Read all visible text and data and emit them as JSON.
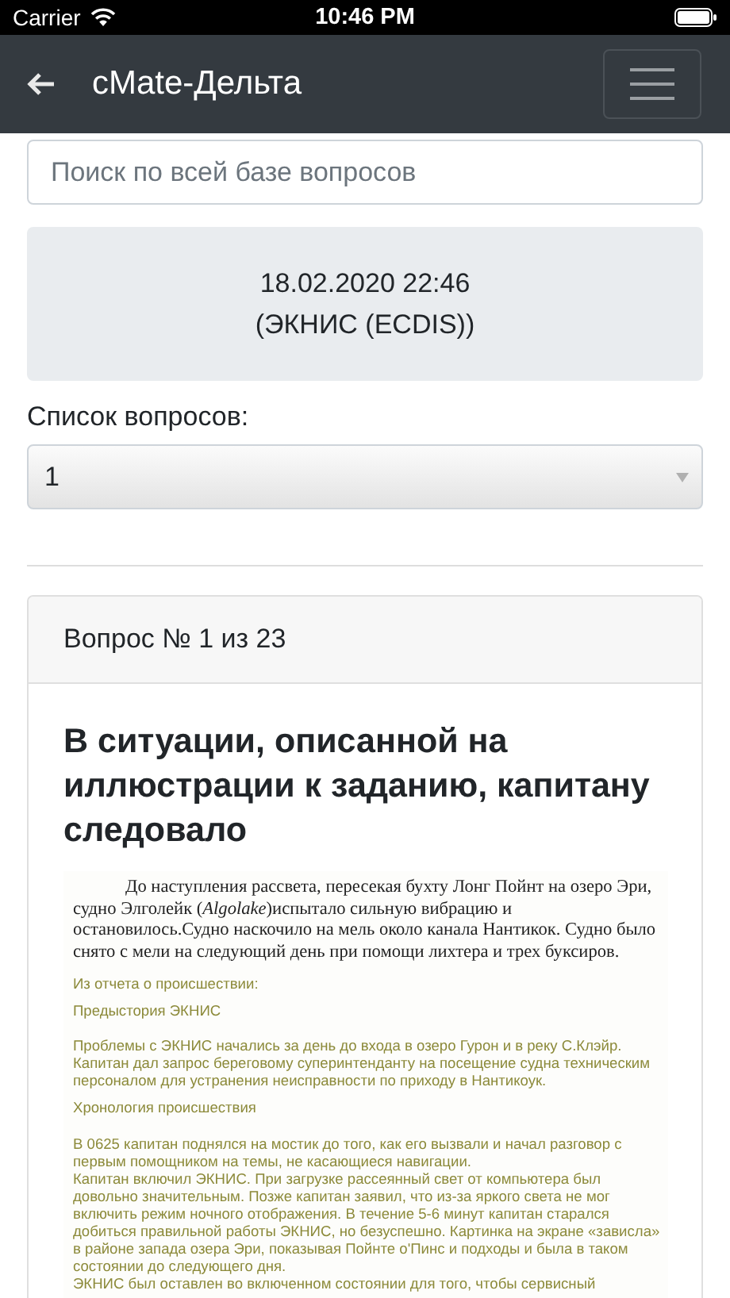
{
  "status_bar": {
    "carrier": "Carrier",
    "time": "10:46 PM"
  },
  "nav": {
    "title": "cMate-Дельта"
  },
  "search": {
    "placeholder": "Поиск по всей базе вопросов"
  },
  "session": {
    "date": "18.02.2020 22:46",
    "subject": "(ЭКНИС (ECDIS))"
  },
  "question_list": {
    "label": "Список вопросов:",
    "value": "1"
  },
  "question": {
    "header": "Вопрос № 1 из 23",
    "text": "В ситуации, описанной на иллюстрации к заданию, капитану следовало",
    "illustration": [
      {
        "kind": "lead",
        "text": "До наступления рассвета, пересекая бухту Лонг Пойнт на озеро Эри, судно Элголейк (*Algolake*)испытало сильную вибрацию и остановилось.Судно наскочило на мель около канала Нантикок. Судно было снято с мели на следующий день при помощи лихтера и трех буксиров."
      },
      {
        "kind": "note",
        "text": "Из отчета о происшествии:"
      },
      {
        "kind": "heading",
        "text": "Предыстория ЭКНИС"
      },
      {
        "kind": "note",
        "text": "Проблемы с ЭКНИС начались за день до входа в озеро Гурон и в реку С.Клэйр. Капитан дал запрос  береговому суперинтенданту на  посещение судна техническим персоналом для устранения неисправности по приходу в Нантикоук."
      },
      {
        "kind": "heading",
        "text": "Хронология происшествия"
      },
      {
        "kind": "body",
        "text": "В 0625 капитан поднялся на мостик до того, как его вызвали и начал разговор с первым помощником на темы, не касающиеся навигации."
      },
      {
        "kind": "body",
        "text": "Капитан включил ЭКНИС. При загрузке рассеянный свет от компьютера был довольно значительным. Позже капитан заявил, что из-за яркого света не мог включить режим ночного отображения. В течение  5-6 минут капитан старался добиться правильной работы ЭКНИС, но безуспешно. Картинка на экране «зависла» в районе запада озера Эри, показывая Пойнте о'Пинс и подходы и была в таком состоянии до следующего дня."
      },
      {
        "kind": "body",
        "text": "ЭКНИС был оставлен во включенном состоянии для того, чтобы сервисный"
      }
    ]
  }
}
